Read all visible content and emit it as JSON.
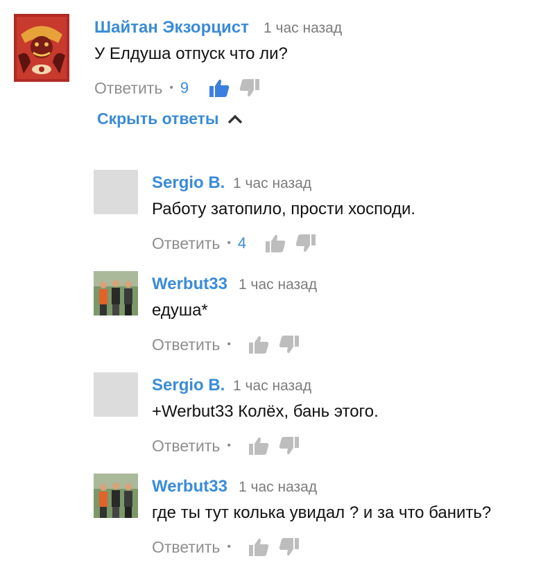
{
  "thread": {
    "comment": {
      "author": "Шайтан Экзорцист",
      "time": "1 час назад",
      "text": "У Елдуша отпуск что ли?",
      "reply_label": "Ответить",
      "separator": "•",
      "likes": "9"
    },
    "toggle_replies_label": "Скрыть ответы",
    "replies": [
      {
        "author": "Sergio B.",
        "time": "1 час назад",
        "text": "Работу затопило, прости хосподи.",
        "reply_label": "Ответить",
        "separator": "•",
        "likes": "4"
      },
      {
        "author": "Werbut33",
        "time": "1 час назад",
        "text": "едуша*",
        "reply_label": "Ответить",
        "separator": "•",
        "likes": ""
      },
      {
        "author": "Sergio B.",
        "time": "1 час назад",
        "text": "+Werbut33 Колёх, бань этого.",
        "reply_label": "Ответить",
        "separator": "•",
        "likes": ""
      },
      {
        "author": "Werbut33",
        "time": "1 час назад",
        "text": "где ты тут колька увидал ? и за что банить?",
        "reply_label": "Ответить",
        "separator": "•",
        "likes": ""
      }
    ]
  },
  "colors": {
    "accent": "#3a8bd8",
    "muted": "#8e8e8e",
    "liked": "#3a7fe0",
    "neutral_icon": "#bdbdbd"
  },
  "icons": {
    "like": "thumbs-up-icon",
    "dislike": "thumbs-down-icon",
    "collapse": "chevron-up-icon"
  }
}
